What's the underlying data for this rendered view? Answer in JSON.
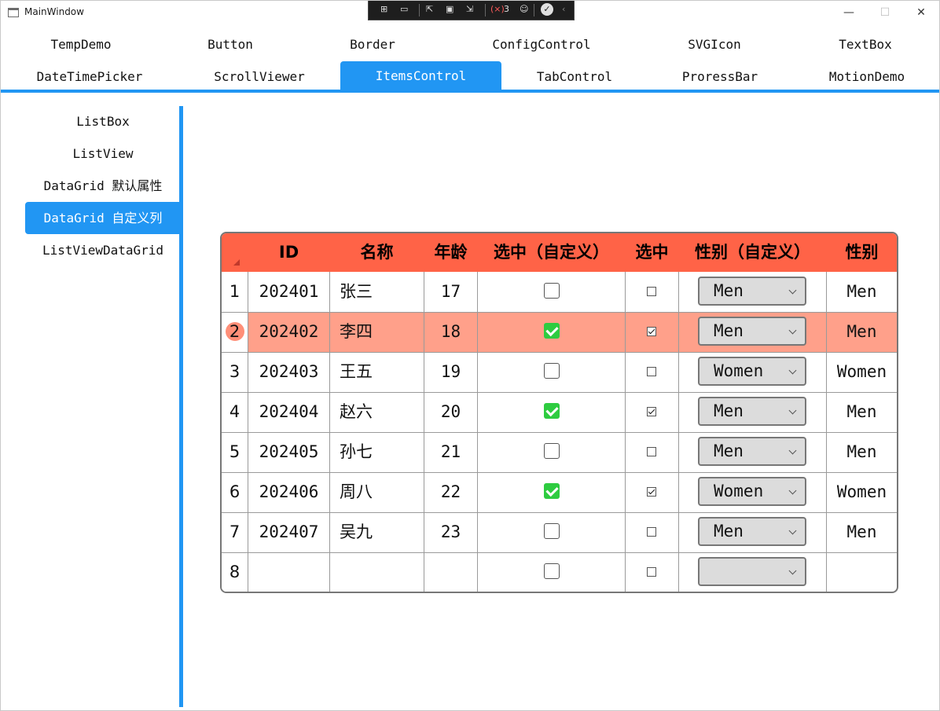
{
  "window": {
    "title": "MainWindow",
    "minimize": "—",
    "maximize": "☐",
    "close": "✕"
  },
  "debug_toolbar": {
    "error_count": "3"
  },
  "tabs": {
    "row1": [
      "TempDemo",
      "Button",
      "Border",
      "ConfigControl",
      "SVGIcon",
      "TextBox"
    ],
    "row2": [
      "DateTimePicker",
      "ScrollViewer",
      "ItemsControl",
      "TabControl",
      "ProressBar",
      "MotionDemo"
    ],
    "active": "ItemsControl"
  },
  "sidebar": {
    "items": [
      "ListBox",
      "ListView",
      "DataGrid 默认属性",
      "DataGrid 自定义列",
      "ListViewDataGrid"
    ],
    "active": "DataGrid 自定义列"
  },
  "grid": {
    "headers": [
      "ID",
      "名称",
      "年龄",
      "选中（自定义）",
      "选中",
      "性别（自定义）",
      "性别"
    ],
    "accent": "#ff6347",
    "selected_row_color": "#ffa08a",
    "rows": [
      {
        "index": "1",
        "id": "202401",
        "name": "张三",
        "age": "17",
        "custom_checked": false,
        "checked": false,
        "custom_gender": "Men",
        "gender": "Men",
        "selected": false
      },
      {
        "index": "2",
        "id": "202402",
        "name": "李四",
        "age": "18",
        "custom_checked": true,
        "checked": true,
        "custom_gender": "Men",
        "gender": "Men",
        "selected": true
      },
      {
        "index": "3",
        "id": "202403",
        "name": "王五",
        "age": "19",
        "custom_checked": false,
        "checked": false,
        "custom_gender": "Women",
        "gender": "Women",
        "selected": false
      },
      {
        "index": "4",
        "id": "202404",
        "name": "赵六",
        "age": "20",
        "custom_checked": true,
        "checked": true,
        "custom_gender": "Men",
        "gender": "Men",
        "selected": false
      },
      {
        "index": "5",
        "id": "202405",
        "name": "孙七",
        "age": "21",
        "custom_checked": false,
        "checked": false,
        "custom_gender": "Men",
        "gender": "Men",
        "selected": false
      },
      {
        "index": "6",
        "id": "202406",
        "name": "周八",
        "age": "22",
        "custom_checked": true,
        "checked": true,
        "custom_gender": "Women",
        "gender": "Women",
        "selected": false
      },
      {
        "index": "7",
        "id": "202407",
        "name": "吴九",
        "age": "23",
        "custom_checked": false,
        "checked": false,
        "custom_gender": "Men",
        "gender": "Men",
        "selected": false
      },
      {
        "index": "8",
        "id": "",
        "name": "",
        "age": "",
        "custom_checked": false,
        "checked": false,
        "custom_gender": "",
        "gender": "",
        "selected": false
      }
    ]
  }
}
